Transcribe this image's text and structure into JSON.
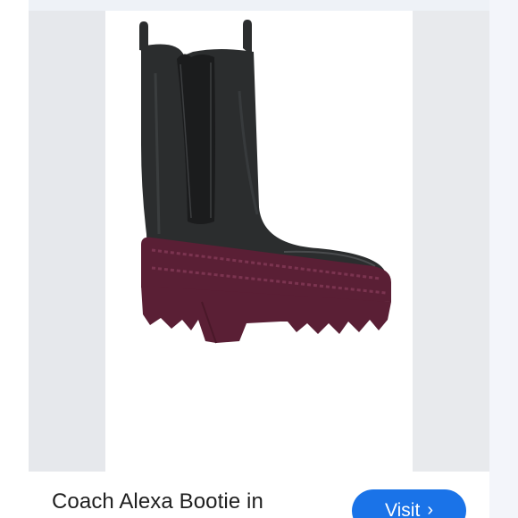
{
  "product": {
    "title": "Coach Alexa Bootie in",
    "visit_label": "Visit",
    "visit_icon": "chevron-right-icon",
    "image_alt": "Black leather chelsea boot with burgundy lug platform sole"
  },
  "colors": {
    "accent": "#1a73e8",
    "boot_leather": "#2b2d2e",
    "sole": "#5a1f35"
  }
}
